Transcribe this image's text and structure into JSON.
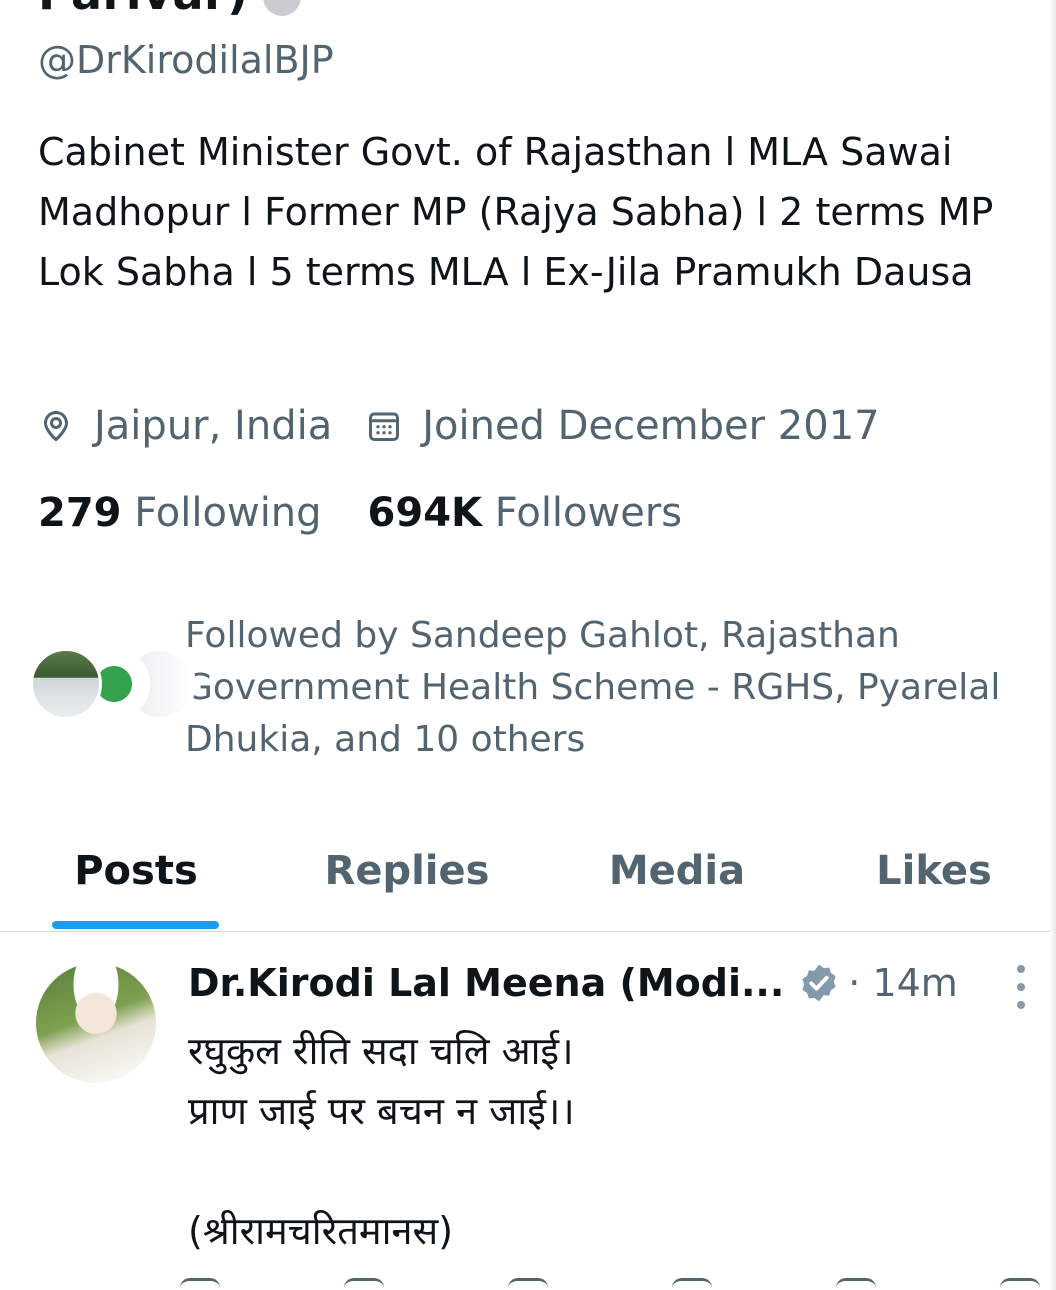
{
  "profile": {
    "name_partial": "Parivar)",
    "handle": "@DrKirodilalBJP",
    "bio": "Cabinet Minister Govt. of Rajasthan l MLA Sawai Madhopur l Former MP (Rajya Sabha) l 2 terms MP Lok Sabha l 5 terms MLA l Ex-Jila Pramukh Dausa",
    "location": "Jaipur, India",
    "joined": "Joined December 2017",
    "following_count": "279",
    "following_label": "Following",
    "followers_count": "694K",
    "followers_label": "Followers",
    "followed_by": "Followed by Sandeep Gahlot, Rajasthan Government Health Scheme - RGHS, Pyarelal Dhukia, and 10 others"
  },
  "tabs": [
    {
      "label": "Posts",
      "active": true
    },
    {
      "label": "Replies",
      "active": false
    },
    {
      "label": "Media",
      "active": false
    },
    {
      "label": "Likes",
      "active": false
    }
  ],
  "post": {
    "author_name": "Dr.Kirodi Lal Meena (Modi...",
    "time": "· 14m",
    "text": "रघुकुल रीति सदा चलि आई।\nप्राण जाई पर बचन न जाई।।\n\n(श्रीरामचरितमानस)"
  },
  "colors": {
    "accent": "#1d9bf0",
    "text_primary": "#0f1419",
    "text_secondary": "#536471",
    "verified_badge": "#829aab"
  },
  "icons": [
    "location-icon",
    "calendar-icon",
    "verified-icon",
    "more-icon"
  ]
}
